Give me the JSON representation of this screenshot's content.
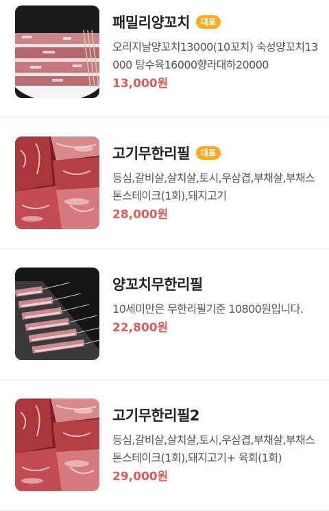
{
  "menu": {
    "items": [
      {
        "title": "패밀리양꼬치",
        "badge": "대표",
        "description": "오리지날양꼬치13000(10꼬치) 숙성양꼬치13000 탕수육16000향라대하20000",
        "price": "13,000원",
        "image": "lamb-skewers-photo"
      },
      {
        "title": "고기무한리필",
        "badge": "대표",
        "description": "등심,갈비살,살치살,토시,우삼겹,부채살,부채스톤스테이크(1회),돼지고기",
        "price": "28,000원",
        "image": "raw-beef-platter-photo"
      },
      {
        "title": "양꼬치무한리필",
        "description": "10세미만은 무한리필기준 10800원입니다.",
        "price": "22,800원",
        "image": "lamb-skewers-tray-photo"
      },
      {
        "title": "고기무한리필2",
        "description": "등심,갈비살,살치살,토시,우삼겹,부채살,부채스톤스테이크(1회),돼지고기+ 육회(1회)",
        "price": "29,000원",
        "image": "raw-beef-platter-photo"
      }
    ]
  },
  "colors": {
    "badge": "#f9ab26",
    "price": "#e05a5a",
    "title": "#222222",
    "description": "#555555",
    "divider": "#ececec"
  }
}
